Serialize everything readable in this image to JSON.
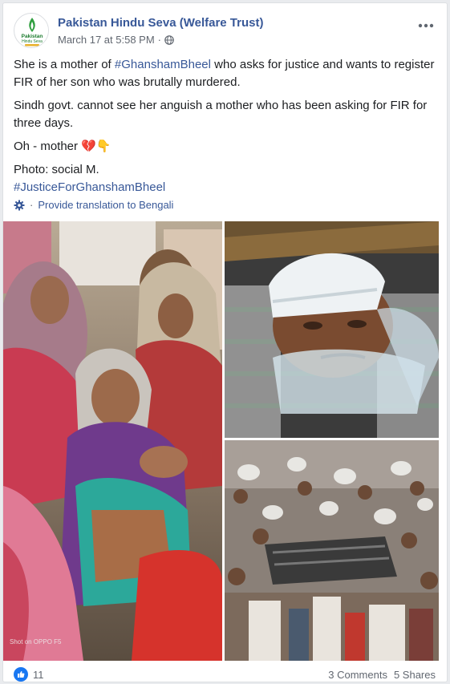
{
  "post": {
    "page_name": "Pakistan Hindu Seva (Welfare Trust)",
    "avatar": {
      "logo_line1": "Pakistan",
      "logo_line2": "Hindu Seva",
      "accent": "#2e9e3e"
    },
    "timestamp": "March 17 at 5:58 PM",
    "separator": "·",
    "privacy_icon": "globe-icon",
    "more_icon": "ellipsis-icon",
    "paragraph1_prefix": "She is a mother of ",
    "paragraph1_hashtag": "#GhanshamBheel",
    "paragraph1_suffix": " who asks for justice and wants to register FIR of her son who was brutally murdered.",
    "paragraph2": "Sindh govt. cannot see her anguish a mother who has been asking for FIR for three days.",
    "paragraph3": "Oh - mother 💔👇",
    "paragraph4_line1": "Photo: social M.",
    "paragraph4_hashtag": "#JusticeForGhanshamBheel",
    "translation": {
      "icon": "gear-icon",
      "separator": "·",
      "label": "Provide translation to Bengali"
    },
    "photos": [
      {
        "name": "photo-grieving-mother",
        "caption": "Shot on OPPO F5"
      },
      {
        "name": "photo-victim"
      },
      {
        "name": "photo-crowd"
      }
    ]
  },
  "footer": {
    "like_icon": "thumbs-up-icon",
    "like_count": "11",
    "comments": "3 Comments",
    "shares": "5 Shares"
  },
  "colors": {
    "link": "#385898",
    "meta": "#616770",
    "like_blue": "#1877f2"
  }
}
